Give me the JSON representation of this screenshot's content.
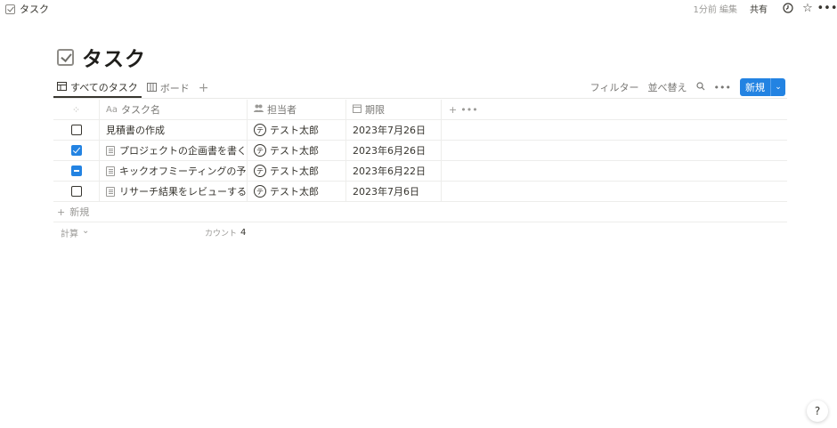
{
  "topbar": {
    "breadcrumb": "タスク",
    "edited": "1分前 編集",
    "share": "共有"
  },
  "page": {
    "title": "タスク"
  },
  "views": {
    "tabs": [
      {
        "label": "すべてのタスク",
        "icon": "table-icon"
      },
      {
        "label": "ボード",
        "icon": "board-icon"
      }
    ],
    "add": "+"
  },
  "toolbar": {
    "filter": "フィルター",
    "sort": "並べ替え",
    "new": "新規"
  },
  "table": {
    "headers": {
      "name_prefix": "Aa",
      "name": "タスク名",
      "assignee": "担当者",
      "due": "期限"
    },
    "rows": [
      {
        "status": "unchecked",
        "name": "見積書の作成",
        "has_doc": false,
        "avatar": "テ",
        "assignee": "テスト太郎",
        "due": "2023年7月26日"
      },
      {
        "status": "checked",
        "name": "プロジェクトの企画書を書く",
        "has_doc": true,
        "avatar": "テ",
        "assignee": "テスト太郎",
        "due": "2023年6月26日"
      },
      {
        "status": "partial",
        "name": "キックオフミーティングの予定を調整",
        "has_doc": true,
        "avatar": "テ",
        "assignee": "テスト太郎",
        "due": "2023年6月22日"
      },
      {
        "status": "unchecked",
        "name": "リサーチ結果をレビューする",
        "has_doc": true,
        "avatar": "テ",
        "assignee": "テスト太郎",
        "due": "2023年7月6日"
      }
    ],
    "new_row": "新規",
    "calc": "計算",
    "count_label": "カウント",
    "count_value": "4"
  },
  "help": "?"
}
